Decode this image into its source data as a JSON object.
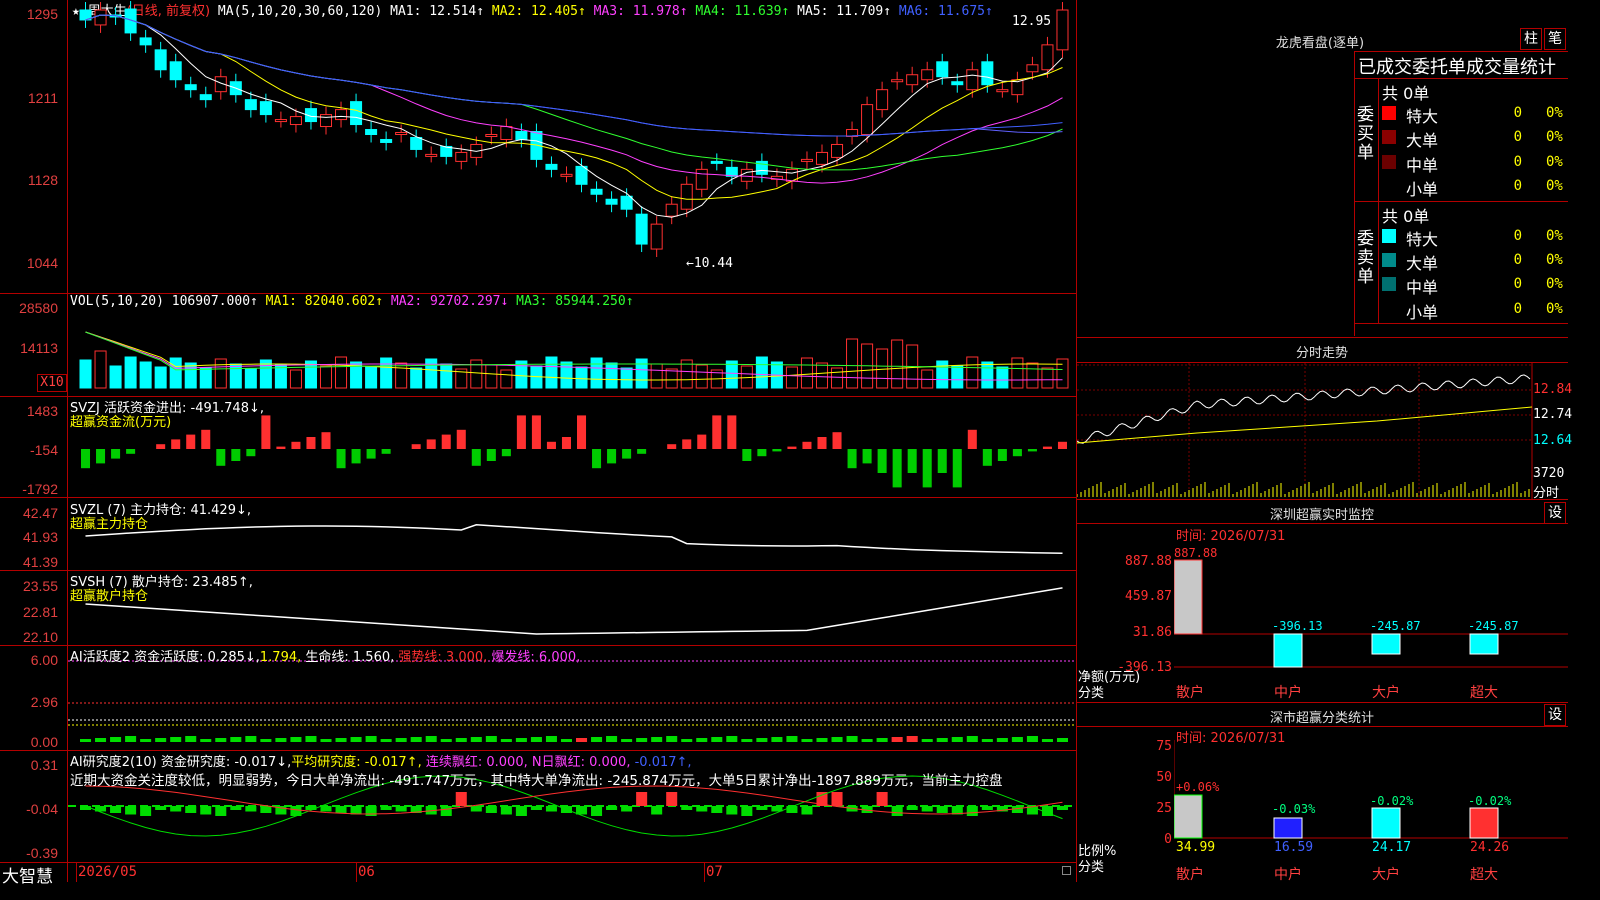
{
  "stock": {
    "star": "★",
    "name": "周大生",
    "period": "(日线, 前复权)",
    "ma_label": "MA(5,10,20,30,60,120)",
    "ma1": "MA1: 12.514↑",
    "ma2": "MA2: 12.405↑",
    "ma3": "MA3: 11.978↑",
    "ma4": "MA4: 11.639↑",
    "ma5": "MA5: 11.709↑",
    "ma6": "MA6: 11.675↑",
    "high_mark": "12.95",
    "low_mark": "←10.44",
    "y_ticks": [
      "1295",
      "1211",
      "1128",
      "1044"
    ]
  },
  "vol": {
    "label": "VOL(5,10,20)",
    "value": "106907.000↑",
    "ma1": "MA1: 82040.602↑",
    "ma2": "MA2: 92702.297↓",
    "ma3": "MA3: 85944.250↑",
    "y_ticks": [
      "28580",
      "14113"
    ],
    "unit": "X10"
  },
  "svzj": {
    "title": "SVZJ  活跃资金进出: -491.748↓,",
    "sub": "超赢资金流(万元)",
    "y_ticks": [
      "1483",
      "-154",
      "-1792"
    ]
  },
  "svzl": {
    "title": "SVZL (7) 主力持仓: 41.429↓,",
    "sub": "超赢主力持仓",
    "y_ticks": [
      "42.47",
      "41.93",
      "41.39"
    ]
  },
  "svsh": {
    "title": "SVSH (7) 散户持仓: 23.485↑,",
    "sub": "超赢散户持仓",
    "y_ticks": [
      "23.55",
      "22.81",
      "22.10"
    ]
  },
  "ai_active": {
    "title": "AI活跃度2 资金活跃度: 0.285↓,",
    "v2": "1.794,",
    "life": "生命线: 1.560,",
    "strong": "强势线: 3.000,",
    "burst": "爆发线: 6.000,",
    "y_ticks": [
      "6.00",
      "2.96",
      "0.00"
    ]
  },
  "ai_research": {
    "title": "AI研究度2(10) 资金研究度: -0.017↓,",
    "avg": "平均研究度: -0.017↑,",
    "cont": "连续飘红: 0.000,",
    "nday": "N日飘红: 0.000,",
    "last": "-0.017↑,",
    "comment": "近期大资金关注度较低，明显弱势，今日大单净流出: -491.747万元，其中特大单净流出: -245.874万元，大单5日累计净出-1897.889万元，当前主力控盘",
    "y_ticks": [
      "0.31",
      "-0.04",
      "-0.39"
    ]
  },
  "xaxis": {
    "brand": "大智慧",
    "labels": [
      "2026/05",
      "06",
      "07"
    ]
  },
  "longhu": {
    "title": "龙虎看盘(逐单)",
    "btn1": "柱",
    "btn2": "笔",
    "header": "已成交委托单成交量统计",
    "buy_label": "委买单",
    "sell_label": "委卖单",
    "buy_total": "共 0单",
    "sell_total": "共 0单",
    "buy_rows": [
      {
        "name": "特大",
        "count": "0",
        "pct": "0%"
      },
      {
        "name": "大单",
        "count": "0",
        "pct": "0%"
      },
      {
        "name": "中单",
        "count": "0",
        "pct": "0%"
      },
      {
        "name": "小单",
        "count": "0",
        "pct": "0%"
      }
    ],
    "sell_rows": [
      {
        "name": "特大",
        "count": "0",
        "pct": "0%"
      },
      {
        "name": "大单",
        "count": "0",
        "pct": "0%"
      },
      {
        "name": "中单",
        "count": "0",
        "pct": "0%"
      },
      {
        "name": "小单",
        "count": "0",
        "pct": "0%"
      }
    ]
  },
  "intraday": {
    "title": "分时走势",
    "y_ticks": [
      "12.84",
      "12.74",
      "12.64"
    ],
    "vol_tick": "3720",
    "vol_label": "分时"
  },
  "sz_monitor": {
    "title": "深圳超赢实时监控",
    "set": "设",
    "time": "时间: 2026/07/31",
    "y_ticks": [
      "887.88",
      "459.87",
      "31.86",
      "-396.13"
    ],
    "top_val": "887.88",
    "axis_label1": "净额(万元)",
    "axis_label2": "分类",
    "cats": [
      "散户",
      "中户",
      "大户",
      "超大"
    ],
    "vals": [
      "887.88",
      "-396.13",
      "-245.87",
      "-245.87"
    ]
  },
  "sz_class": {
    "title": "深市超赢分类统计",
    "set": "设",
    "time": "时间: 2026/07/31",
    "y_ticks": [
      "75",
      "50",
      "25",
      "0"
    ],
    "axis_label1": "比例%",
    "axis_label2": "分类",
    "cats": [
      "散户",
      "中户",
      "大户",
      "超大"
    ],
    "top_vals": [
      "+0.06%",
      "-0.03%",
      "-0.02%",
      "-0.02%"
    ],
    "bottom_vals": [
      "34.99",
      "16.59",
      "24.17",
      "24.26"
    ]
  },
  "colors": {
    "up": "#ff3030",
    "down": "#00ffff",
    "grid": "#b30000",
    "ma1": "#ffffff",
    "ma2": "#ffff00",
    "ma3": "#ff40ff",
    "ma4": "#30ff30",
    "ma5": "#6060ff",
    "ma6": "#4060ff"
  }
}
